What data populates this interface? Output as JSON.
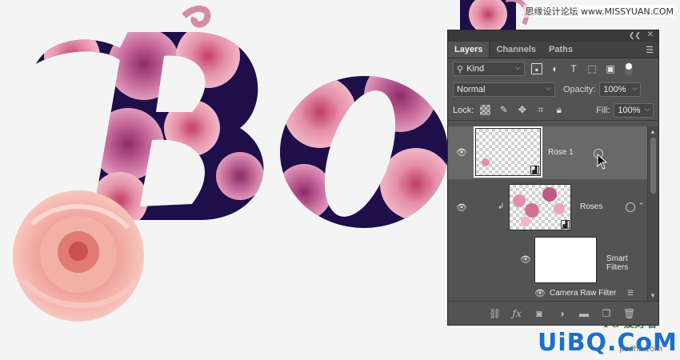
{
  "watermark_top": "思缘设计论坛 www.MISSYUAN.COM",
  "watermark_bottom": {
    "ps": "PS 爱好者",
    "brand": "UiBQ.CoM",
    "small": "psahz.com"
  },
  "panel": {
    "tabs": [
      {
        "label": "Layers",
        "active": true
      },
      {
        "label": "Channels",
        "active": false
      },
      {
        "label": "Paths",
        "active": false
      }
    ],
    "filter": {
      "kind_label": "Kind"
    },
    "blend_mode": "Normal",
    "opacity_label": "Opacity:",
    "opacity_value": "100%",
    "lock_label": "Lock:",
    "fill_label": "Fill:",
    "fill_value": "100%",
    "layers": [
      {
        "name": "Rose 1",
        "selected": true,
        "visible": true,
        "type": "smart-object"
      },
      {
        "name": "Roses",
        "selected": false,
        "visible": true,
        "type": "smart-object",
        "clipped": true
      },
      {
        "name": "Smart Filters",
        "selected": false,
        "visible": true,
        "type": "filter-mask"
      },
      {
        "name": "Camera Raw Filter",
        "selected": false,
        "visible": true,
        "type": "filter"
      }
    ]
  },
  "colors": {
    "panel_bg": "#535353",
    "selected_row": "#696969",
    "letter_fill": "#1e0e4a",
    "rose_pink": "#e6a0b4"
  }
}
